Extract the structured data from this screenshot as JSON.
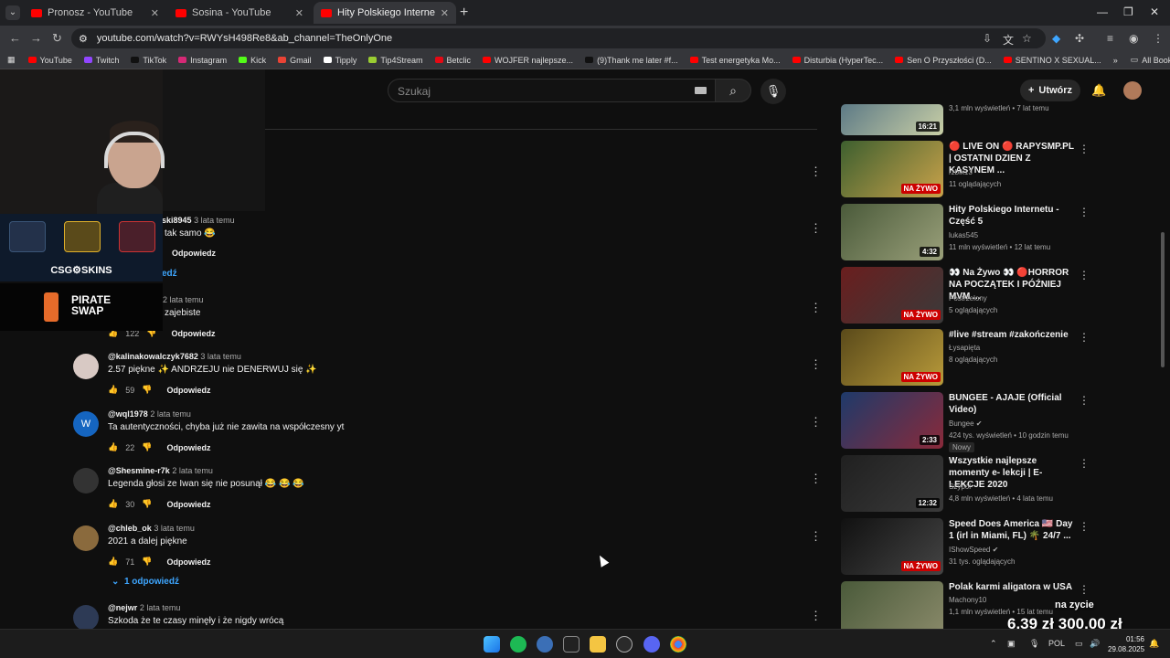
{
  "browser": {
    "tabs": [
      {
        "title": "Pronosz - YouTube",
        "active": false
      },
      {
        "title": "Sosina - YouTube",
        "active": false
      },
      {
        "title": "Hity Polskiego Internetu - YouTube",
        "active": true
      }
    ],
    "url": "youtube.com/watch?v=RWYsH498Re8&ab_channel=TheOnlyOne",
    "bookmarks": [
      "YouTube",
      "Twitch",
      "TikTok",
      "Instagram",
      "Kick",
      "Gmail",
      "Tipply",
      "Tip4Stream",
      "Betclic",
      "WOJFER najlepsze...",
      "(9)Thank me later #f...",
      "Test energetyka Mo...",
      "Disturbia (HyperTec...",
      "Sen O Przyszłości (D...",
      "SENTINO X SEXUAL..."
    ],
    "all_bookmarks": "All Bookmarks"
  },
  "header": {
    "search_placeholder": "Szukaj",
    "create_label": "Utwórz"
  },
  "overlay": {
    "ad1_label": "CSG⚙SKINS",
    "ad2_label_1": "PIRATE",
    "ad2_label_2": "SWAP"
  },
  "comments": [
    {
      "author": "ski8945",
      "time": "3 lata temu",
      "text": "tak samo 😂",
      "likes": "",
      "reply": "Odpowiedz"
    },
    {
      "author": "",
      "time": "2 lata temu",
      "text": "zajebiste",
      "likes": "122",
      "reply": "Odpowiedz"
    },
    {
      "author": "@kalinakowalczyk7682",
      "time": "3 lata temu",
      "text": "2.57 piękne ✨ ANDRZEJU nie DENERWUJ się ✨",
      "likes": "59",
      "reply": "Odpowiedz"
    },
    {
      "author": "@wql1978",
      "time": "2 lata temu",
      "text": "Ta autentyczności, chyba już nie zawita na współczesny yt",
      "likes": "22",
      "reply": "Odpowiedz"
    },
    {
      "author": "@Shesmine-r7k",
      "time": "2 lata temu",
      "text": "Legenda głosi ze Iwan się nie posunął 😂 😂 😂",
      "likes": "30",
      "reply": "Odpowiedz"
    },
    {
      "author": "@chleb_ok",
      "time": "3 lata temu",
      "text": "2021 a dalej piękne",
      "likes": "71",
      "reply": "Odpowiedz"
    },
    {
      "author": "@nejwr",
      "time": "2 lata temu",
      "text": "Szkoda że te czasy minęły i że nigdy wrócą",
      "likes": "",
      "reply": ""
    }
  ],
  "replies_link": "1 odpowiedź",
  "partial_link": "edź",
  "sidebar": [
    {
      "title": "",
      "channel": "",
      "meta": "3,1 mln wyświetleń • 7 lat temu",
      "badge": "16:21",
      "live": false
    },
    {
      "title": "🔴 LIVE ON 🔴 RAPYSMP.PL | OSTATNI DZIEN Z KASYNEM ...",
      "channel": "rzbik13",
      "meta": "11 oglądających",
      "badge": "NA ŻYWO",
      "live": true
    },
    {
      "title": "Hity Polskiego Internetu - Część 5",
      "channel": "lukas545",
      "meta": "11 mln wyświetleń • 12 lat temu",
      "badge": "4:32",
      "live": false
    },
    {
      "title": "👀 Na Żywo 👀 🔴HORROR NA POCZĄTEK I PÓŹNIEJ MVM ...",
      "channel": "Postrzelony",
      "meta": "5 oglądających",
      "badge": "NA ŻYWO",
      "live": true
    },
    {
      "title": "#live #stream #zakończenie",
      "channel": "Łysapięta",
      "meta": "8 oglądających",
      "badge": "NA ŻYWO",
      "live": true
    },
    {
      "title": "BUNGEE - AJAJE (Official Video)",
      "channel": "Bungee ✔",
      "meta": "424 tys. wyświetleń • 10 godzin temu",
      "badge": "2:33",
      "live": false,
      "new": "Nowy"
    },
    {
      "title": "Wszystkie najlepsze momenty e- lekcji | E-LEKCJE 2020",
      "channel": "Szypol",
      "meta": "4,8 mln wyświetleń • 4 lata temu",
      "badge": "12:32",
      "live": false
    },
    {
      "title": "Speed Does America 🇺🇸 Day 1 (irl in Miami, FL) 🌴 24/7 ...",
      "channel": "IShowSpeed ✔",
      "meta": "31 tys. oglądających",
      "badge": "NA ŻYWO",
      "live": true
    },
    {
      "title": "Polak karmi aligatora w USA",
      "channel": "Machony10",
      "meta": "1,1 mln wyświetleń • 15 lat temu",
      "badge": "",
      "live": false
    }
  ],
  "donation": {
    "label": "na zycie",
    "amount": "6,39 zł   300,00 zł"
  },
  "system": {
    "lang": "POL",
    "time": "01:56",
    "date": "29.08.2025"
  },
  "colors": {
    "bg": "#0f0f0f",
    "accent": "#3ea6ff",
    "live": "#cc0000"
  }
}
